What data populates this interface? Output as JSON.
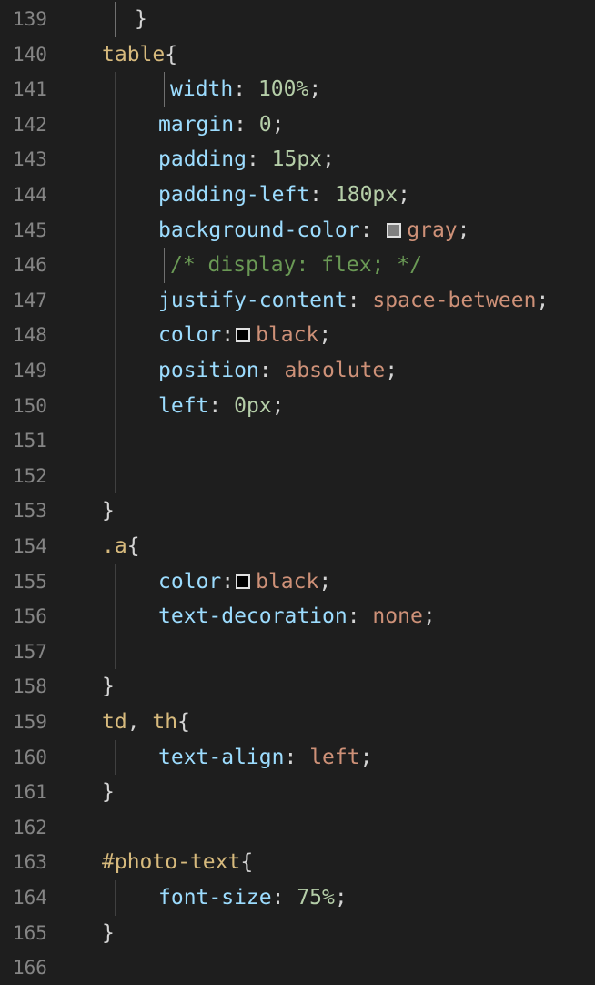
{
  "editor": {
    "colors": {
      "background": "#1e1e1e",
      "line_number": "#858585",
      "selector": "#d7ba7d",
      "property": "#9cdcfe",
      "number": "#b5cea8",
      "string": "#ce9178",
      "comment": "#6a9955",
      "punctuation": "#d4d4d4"
    },
    "lines": [
      {
        "n": "139",
        "segments": [
          {
            "t": "}",
            "c": "pun"
          }
        ]
      },
      {
        "n": "140",
        "segments": [
          {
            "t": "table",
            "c": "sel"
          },
          {
            "t": "{",
            "c": "pun"
          }
        ]
      },
      {
        "n": "141",
        "segments": [
          {
            "t": "width",
            "c": "prop"
          },
          {
            "t": ": ",
            "c": "pun"
          },
          {
            "t": "100%",
            "c": "num"
          },
          {
            "t": ";",
            "c": "pun"
          }
        ]
      },
      {
        "n": "142",
        "segments": [
          {
            "t": "margin",
            "c": "prop"
          },
          {
            "t": ": ",
            "c": "pun"
          },
          {
            "t": "0",
            "c": "num"
          },
          {
            "t": ";",
            "c": "pun"
          }
        ]
      },
      {
        "n": "143",
        "segments": [
          {
            "t": "padding",
            "c": "prop"
          },
          {
            "t": ": ",
            "c": "pun"
          },
          {
            "t": "15px",
            "c": "num"
          },
          {
            "t": ";",
            "c": "pun"
          }
        ]
      },
      {
        "n": "144",
        "segments": [
          {
            "t": "padding-left",
            "c": "prop"
          },
          {
            "t": ": ",
            "c": "pun"
          },
          {
            "t": "180px",
            "c": "num"
          },
          {
            "t": ";",
            "c": "pun"
          }
        ]
      },
      {
        "n": "145",
        "segments": [
          {
            "t": "background-color",
            "c": "prop"
          },
          {
            "t": ": ",
            "c": "pun"
          },
          {
            "swatch": "#808080"
          },
          {
            "t": "gray",
            "c": "str"
          },
          {
            "t": ";",
            "c": "pun"
          }
        ]
      },
      {
        "n": "146",
        "segments": [
          {
            "t": "/* display: flex; */",
            "c": "cmt"
          }
        ]
      },
      {
        "n": "147",
        "segments": [
          {
            "t": "justify-content",
            "c": "prop"
          },
          {
            "t": ": ",
            "c": "pun"
          },
          {
            "t": "space-between",
            "c": "str"
          },
          {
            "t": ";",
            "c": "pun"
          }
        ]
      },
      {
        "n": "148",
        "segments": [
          {
            "t": "color",
            "c": "prop"
          },
          {
            "t": ":",
            "c": "pun"
          },
          {
            "swatch": "#000000"
          },
          {
            "t": "black",
            "c": "str"
          },
          {
            "t": ";",
            "c": "pun"
          }
        ]
      },
      {
        "n": "149",
        "segments": [
          {
            "t": "position",
            "c": "prop"
          },
          {
            "t": ": ",
            "c": "pun"
          },
          {
            "t": "absolute",
            "c": "str"
          },
          {
            "t": ";",
            "c": "pun"
          }
        ]
      },
      {
        "n": "150",
        "segments": [
          {
            "t": "left",
            "c": "prop"
          },
          {
            "t": ": ",
            "c": "pun"
          },
          {
            "t": "0px",
            "c": "num"
          },
          {
            "t": ";",
            "c": "pun"
          }
        ]
      },
      {
        "n": "151",
        "segments": []
      },
      {
        "n": "152",
        "segments": []
      },
      {
        "n": "153",
        "segments": [
          {
            "t": "}",
            "c": "pun"
          }
        ]
      },
      {
        "n": "154",
        "segments": [
          {
            "t": ".a",
            "c": "sel"
          },
          {
            "t": "{",
            "c": "pun"
          }
        ]
      },
      {
        "n": "155",
        "segments": [
          {
            "t": "color",
            "c": "prop"
          },
          {
            "t": ":",
            "c": "pun"
          },
          {
            "swatch": "#000000"
          },
          {
            "t": "black",
            "c": "str"
          },
          {
            "t": ";",
            "c": "pun"
          }
        ]
      },
      {
        "n": "156",
        "segments": [
          {
            "t": "text-decoration",
            "c": "prop"
          },
          {
            "t": ": ",
            "c": "pun"
          },
          {
            "t": "none",
            "c": "str"
          },
          {
            "t": ";",
            "c": "pun"
          }
        ]
      },
      {
        "n": "157",
        "segments": []
      },
      {
        "n": "158",
        "segments": [
          {
            "t": "}",
            "c": "pun"
          }
        ]
      },
      {
        "n": "159",
        "segments": [
          {
            "t": "td",
            "c": "sel"
          },
          {
            "t": ", ",
            "c": "pun"
          },
          {
            "t": "th",
            "c": "sel"
          },
          {
            "t": "{",
            "c": "pun"
          }
        ]
      },
      {
        "n": "160",
        "segments": [
          {
            "t": "text-align",
            "c": "prop"
          },
          {
            "t": ": ",
            "c": "pun"
          },
          {
            "t": "left",
            "c": "str"
          },
          {
            "t": ";",
            "c": "pun"
          }
        ]
      },
      {
        "n": "161",
        "segments": [
          {
            "t": "}",
            "c": "pun"
          }
        ]
      },
      {
        "n": "162",
        "segments": []
      },
      {
        "n": "163",
        "segments": [
          {
            "t": "#photo-text",
            "c": "sel"
          },
          {
            "t": "{",
            "c": "pun"
          }
        ]
      },
      {
        "n": "164",
        "segments": [
          {
            "t": "font-size",
            "c": "prop"
          },
          {
            "t": ": ",
            "c": "pun"
          },
          {
            "t": "75%",
            "c": "num"
          },
          {
            "t": ";",
            "c": "pun"
          }
        ]
      },
      {
        "n": "165",
        "segments": [
          {
            "t": "}",
            "c": "pun"
          }
        ]
      },
      {
        "n": "166",
        "segments": []
      }
    ]
  }
}
